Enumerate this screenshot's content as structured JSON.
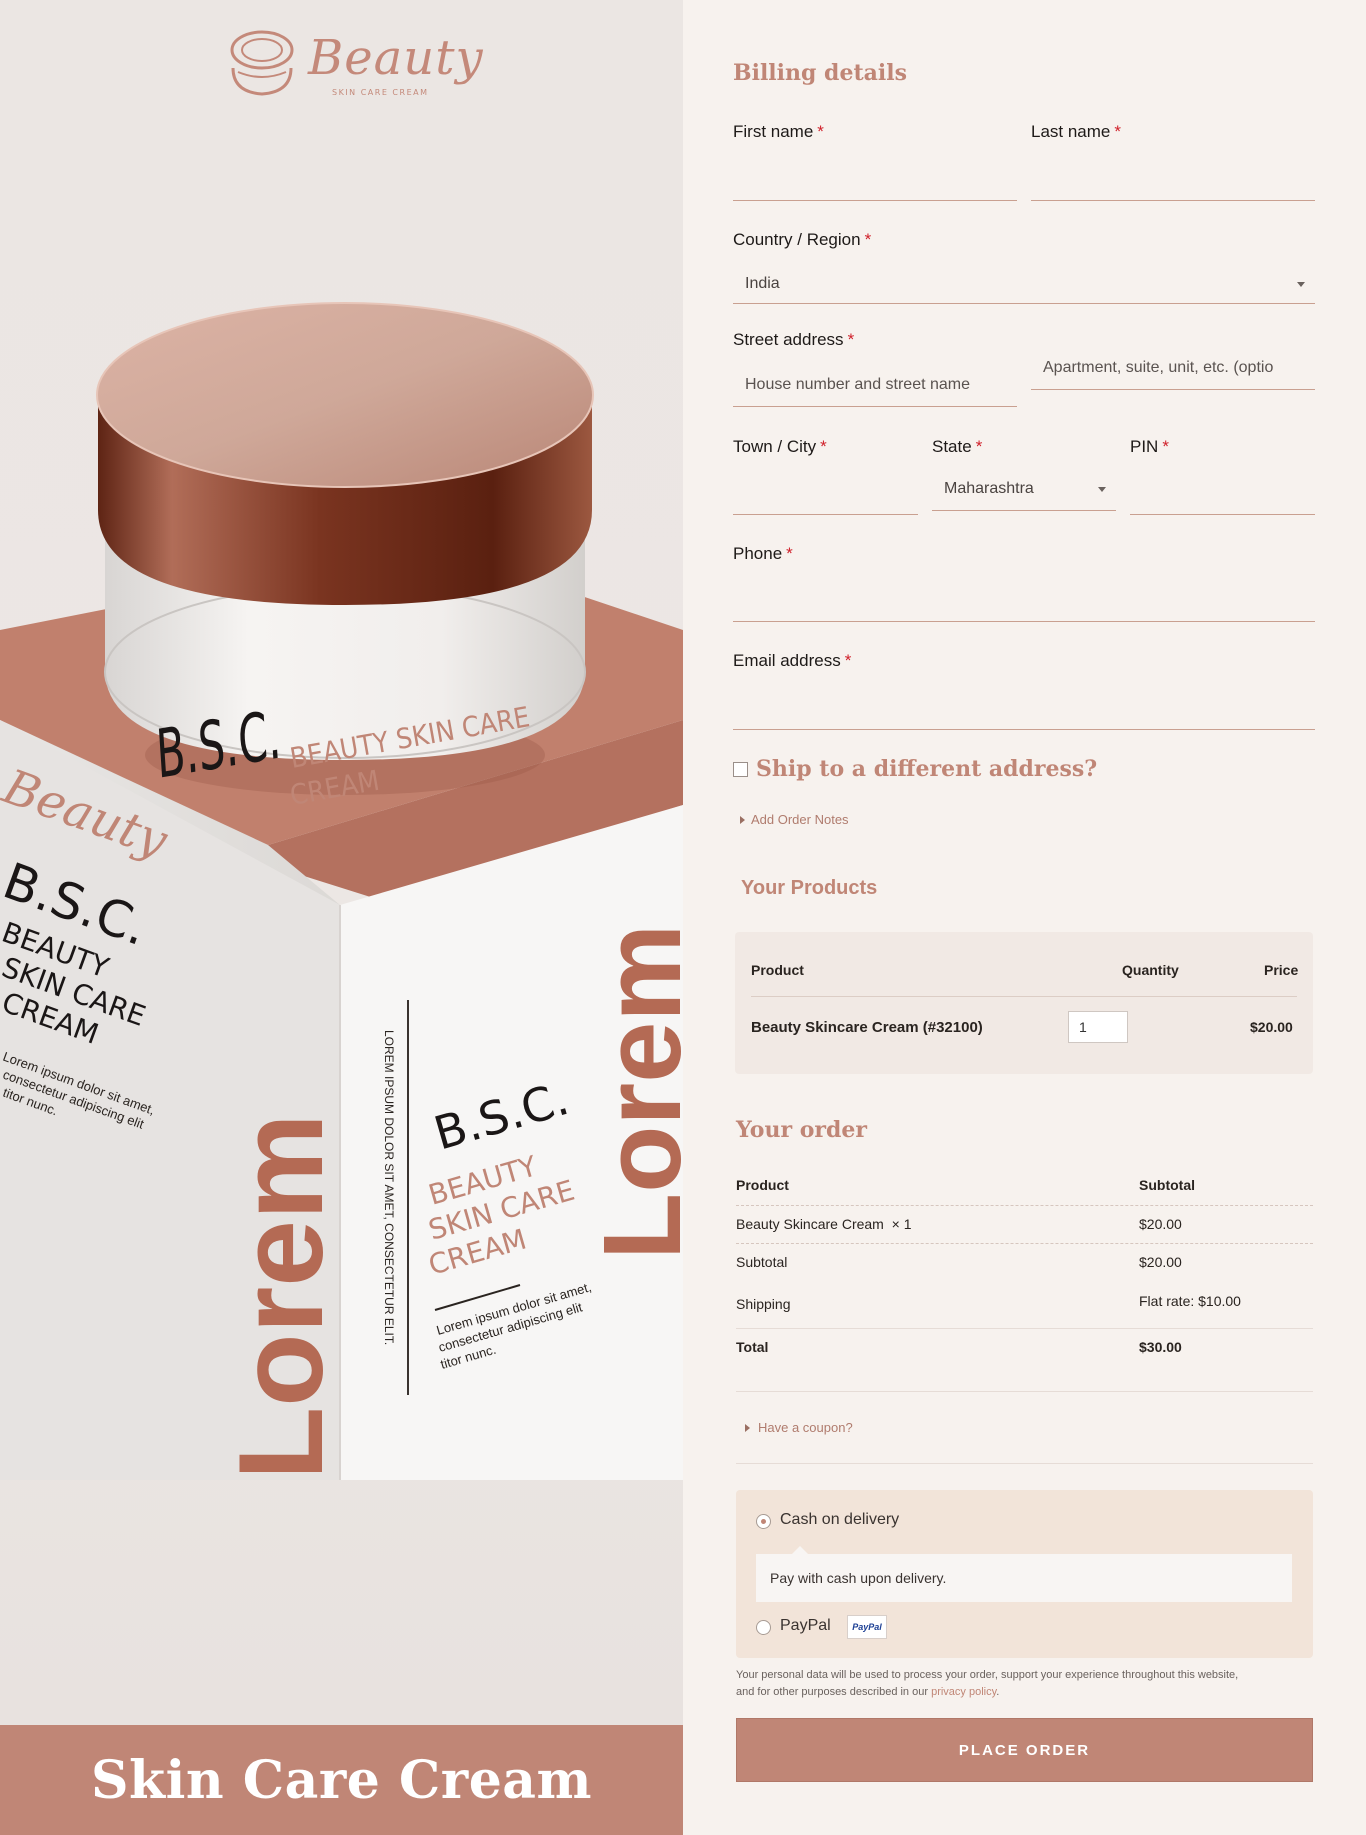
{
  "brand": {
    "logo_word": "Beauty",
    "logo_sub": "SKIN CARE CREAM"
  },
  "hero": {
    "footer_title": "Skin Care Cream",
    "jar_text_main": "B.S.C.",
    "jar_text_sub_1": "BEAUTY SKIN CARE",
    "jar_text_sub_2": "CREAM",
    "box_lorem": "Lorem",
    "box_side_text": "LOREM IPSUM DOLOR SIT AMET, CONSECTETUR ELIT.",
    "box_body": "Lorem ipsum dolor sit amet, consectetur adipiscing elit titor nunc.",
    "box_left_line1": "BEAUTY",
    "box_left_line2": "SKIN CARE",
    "box_left_line3": "CREAM",
    "box_left_body": "Lorem ipsum dolor sit amet, consectetur adipiscing elit titor nunc."
  },
  "billing": {
    "title": "Billing details",
    "first_name_label": "First name",
    "last_name_label": "Last name",
    "first_name_value": "",
    "last_name_value": "",
    "country_label": "Country / Region",
    "country_value": "India",
    "street_label": "Street address",
    "street_placeholder": "House number and street name",
    "apartment_placeholder": "Apartment, suite, unit, etc. (optio",
    "town_label": "Town / City",
    "state_label": "State",
    "state_value": "Maharashtra",
    "pin_label": "PIN",
    "phone_label": "Phone",
    "email_label": "Email address",
    "required_mark": "*"
  },
  "shipping": {
    "ship_different_label": "Ship to a different address?",
    "order_notes_label": "Add Order Notes"
  },
  "products": {
    "title": "Your Products",
    "headers": {
      "product": "Product",
      "quantity": "Quantity",
      "price": "Price"
    },
    "rows": [
      {
        "product": "Beauty Skincare Cream (#32100)",
        "quantity": "1",
        "price": "$20.00"
      }
    ]
  },
  "order": {
    "title": "Your order",
    "header_product": "Product",
    "header_subtotal": "Subtotal",
    "item_name": "Beauty Skincare Cream",
    "item_qty": "× 1",
    "item_subtotal": "$20.00",
    "subtotal_label": "Subtotal",
    "subtotal_value": "$20.00",
    "shipping_label": "Shipping",
    "shipping_value": "Flat rate: $10.00",
    "total_label": "Total",
    "total_value": "$30.00",
    "coupon_label": "Have a coupon?"
  },
  "payment": {
    "cod_label": "Cash on delivery",
    "cod_description": "Pay with cash upon delivery.",
    "paypal_label": "PayPal",
    "paypal_badge": "PayPal",
    "selected": "cod",
    "privacy_text_1": "Your personal data will be used to process your order, support your experience throughout this website,",
    "privacy_text_2": "and for other purposes described in our",
    "privacy_link": "privacy policy",
    "privacy_end": ".",
    "place_order": "PLACE ORDER"
  },
  "colors": {
    "accent": "#c08676",
    "accent_dark": "#8a3b28",
    "panel_bg": "#f7f2ee",
    "payment_bg": "#f2e4d9",
    "required": "#d0202a"
  }
}
